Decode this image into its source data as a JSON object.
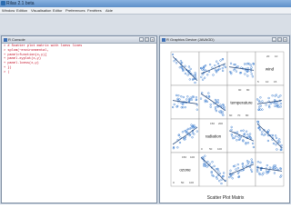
{
  "app": {
    "title": "Rilas 2.1 beta"
  },
  "menu": [
    "Window",
    "Edition",
    "Visualisation",
    "Editor",
    "Preferences",
    "Fenêtres",
    "Aide"
  ],
  "console": {
    "title": "R Console",
    "lines": [
      "> # Scatter plot matrix with loess lines",
      "> splom(~environmental,",
      "+ panel=function(x,y){",
      "+ panel.xyplot(x,y)",
      "+ panel.loess(x,y)",
      "+ })",
      "> |"
    ]
  },
  "graphics": {
    "title": "R Graphics Device (JAVAGD)",
    "caption": "Scatter Plot Matrix",
    "variables": [
      "ozone",
      "radiation",
      "temperature",
      "wind"
    ],
    "ticks": {
      "wind": [
        "5",
        "10",
        "15",
        "20",
        "10",
        "15",
        "20"
      ],
      "temperature": [
        "60",
        "70",
        "80",
        "90",
        "80",
        "90"
      ],
      "radiation": [
        "0",
        "50",
        "100",
        "150",
        "200",
        "250",
        "300",
        "150",
        "200",
        "250"
      ],
      "ozone": [
        "0",
        "50",
        "100",
        "150",
        "100",
        "150"
      ]
    },
    "point_color": "#3f7fd0",
    "line_color": "#1a3e73"
  }
}
